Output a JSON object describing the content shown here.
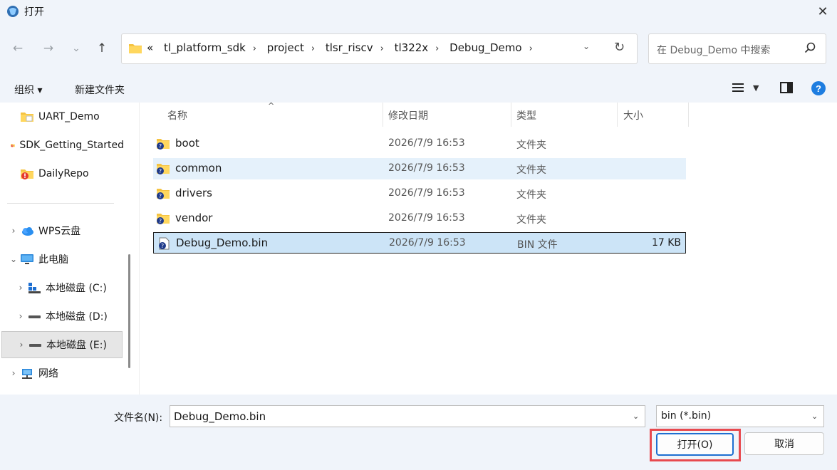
{
  "window": {
    "title": "打开",
    "close_glyph": "✕"
  },
  "nav": {
    "back_glyph": "←",
    "forward_glyph": "→",
    "recent_glyph": "⌄",
    "up_glyph": "↑",
    "path_prefix": "«",
    "path": [
      "tl_platform_sdk",
      "project",
      "tlsr_riscv",
      "tl322x",
      "Debug_Demo"
    ],
    "path_sep": "›",
    "dropdown_glyph": "⌄",
    "refresh_glyph": "↻",
    "search_placeholder": "在 Debug_Demo 中搜索"
  },
  "commands": {
    "organize": "组织 ▾",
    "new_folder": "新建文件夹"
  },
  "sidebar": {
    "items": [
      {
        "label": "UART_Demo",
        "icon": "folder-icon",
        "chevron": ""
      },
      {
        "label": "SDK_Getting_Started",
        "icon": "folder-warning-icon",
        "chevron": ""
      },
      {
        "label": "DailyRepo",
        "icon": "folder-warning-icon",
        "chevron": ""
      },
      {
        "label": "WPS云盘",
        "icon": "cloud-icon",
        "chevron": "›"
      },
      {
        "label": "此电脑",
        "icon": "computer-icon",
        "chevron": "⌄"
      },
      {
        "label": "本地磁盘 (C:)",
        "icon": "windows-drive-icon",
        "chevron": "›"
      },
      {
        "label": "本地磁盘 (D:)",
        "icon": "drive-icon",
        "chevron": "›"
      },
      {
        "label": "本地磁盘 (E:)",
        "icon": "drive-icon",
        "chevron": "›"
      },
      {
        "label": "网络",
        "icon": "network-icon",
        "chevron": "›"
      }
    ]
  },
  "columns": {
    "name": "名称",
    "date": "修改日期",
    "type": "类型",
    "size": "大小",
    "sort_glyph": "^"
  },
  "files": [
    {
      "name": "boot",
      "date": "2026/7/9 16:53",
      "type": "文件夹",
      "size": ""
    },
    {
      "name": "common",
      "date": "2026/7/9 16:53",
      "type": "文件夹",
      "size": ""
    },
    {
      "name": "drivers",
      "date": "2026/7/9 16:53",
      "type": "文件夹",
      "size": ""
    },
    {
      "name": "vendor",
      "date": "2026/7/9 16:53",
      "type": "文件夹",
      "size": ""
    },
    {
      "name": "Debug_Demo.bin",
      "date": "2026/7/9 16:53",
      "type": "BIN 文件",
      "size": "17 KB"
    }
  ],
  "footer": {
    "filename_label": "文件名(N):",
    "filename_value": "Debug_Demo.bin",
    "filetype_value": "bin (*.bin)",
    "dd_glyph": "⌄",
    "open_label": "打开(O)",
    "cancel_label": "取消"
  },
  "colors": {
    "accent": "#1e6fd1",
    "highlight": "#e84a4f",
    "selection": "#cce4f7",
    "hover": "#e5f1fb",
    "chrome": "#f0f4fa"
  }
}
